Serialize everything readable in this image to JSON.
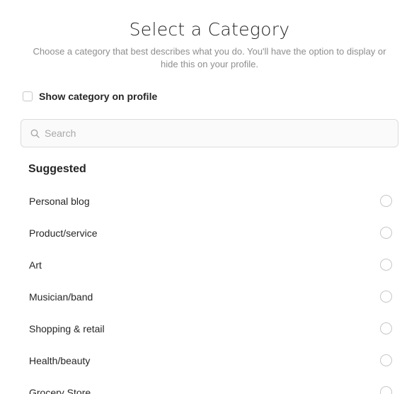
{
  "header": {
    "title": "Select a Category",
    "subtitle": "Choose a category that best describes what you do. You'll have the option to display or hide this on your profile."
  },
  "show_category": {
    "label": "Show category on profile",
    "checked": false
  },
  "search": {
    "placeholder": "Search",
    "value": "",
    "icon": "search-icon"
  },
  "suggested": {
    "title": "Suggested",
    "items": [
      {
        "label": "Personal blog",
        "selected": false
      },
      {
        "label": "Product/service",
        "selected": false
      },
      {
        "label": "Art",
        "selected": false
      },
      {
        "label": "Musician/band",
        "selected": false
      },
      {
        "label": "Shopping & retail",
        "selected": false
      },
      {
        "label": "Health/beauty",
        "selected": false
      },
      {
        "label": "Grocery Store",
        "selected": false
      }
    ]
  },
  "colors": {
    "text_primary": "#262626",
    "text_secondary": "#8e8e8e",
    "border": "#dbdbdb",
    "control_border": "#c7c7c7",
    "search_bg": "#fafafa"
  }
}
